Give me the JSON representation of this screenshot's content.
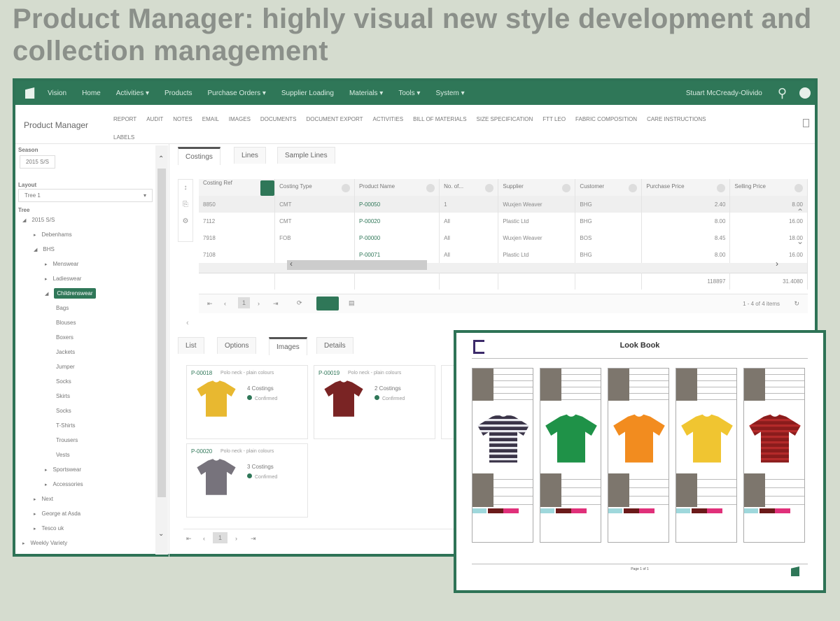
{
  "title": "Product Manager: highly visual new style development and collection management",
  "nav": {
    "brand": "Vision",
    "items": [
      "Home",
      "Activities ▾",
      "Products",
      "Purchase Orders ▾",
      "Supplier Loading",
      "Materials ▾",
      "Tools ▾",
      "System ▾"
    ],
    "user": "Stuart McCready-Olivido"
  },
  "header": {
    "title": "Product Manager",
    "tabs": [
      "REPORT",
      "AUDIT",
      "NOTES",
      "EMAIL",
      "IMAGES",
      "DOCUMENTS",
      "DOCUMENT EXPORT",
      "ACTIVITIES",
      "BILL OF MATERIALS",
      "SIZE SPECIFICATION",
      "FTT LEO",
      "FABRIC COMPOSITION",
      "CARE INSTRUCTIONS",
      "LABELS"
    ]
  },
  "sidebar": {
    "season_label": "Season",
    "season_value": "2015 S/S",
    "layout_label": "Layout",
    "layout_value": "Tree 1",
    "tree_label": "Tree",
    "tree": [
      {
        "t": "2015 S/S",
        "l": 0,
        "e": "◢"
      },
      {
        "t": "Debenhams",
        "l": 1,
        "e": "▸"
      },
      {
        "t": "BHS",
        "l": 1,
        "e": "◢"
      },
      {
        "t": "Menswear",
        "l": 2,
        "e": "▸"
      },
      {
        "t": "Ladieswear",
        "l": 2,
        "e": "▸"
      },
      {
        "t": "Childrenswear",
        "l": 2,
        "e": "◢",
        "sel": true
      },
      {
        "t": "Bags",
        "l": 3
      },
      {
        "t": "Blouses",
        "l": 3
      },
      {
        "t": "Boxers",
        "l": 3
      },
      {
        "t": "Jackets",
        "l": 3
      },
      {
        "t": "Jumper",
        "l": 3
      },
      {
        "t": "Socks",
        "l": 3
      },
      {
        "t": "Skirts",
        "l": 3
      },
      {
        "t": "Socks",
        "l": 3
      },
      {
        "t": "T-Shirts",
        "l": 3
      },
      {
        "t": "Trousers",
        "l": 3
      },
      {
        "t": "Vests",
        "l": 3
      },
      {
        "t": "Sportswear",
        "l": 2,
        "e": "▸"
      },
      {
        "t": "Accessories",
        "l": 2,
        "e": "▸"
      },
      {
        "t": "Next",
        "l": 1,
        "e": "▸"
      },
      {
        "t": "George at Asda",
        "l": 1,
        "e": "▸"
      },
      {
        "t": "Tesco uk",
        "l": 1,
        "e": "▸"
      },
      {
        "t": "Weekly Variety",
        "l": 0,
        "e": "▸"
      }
    ]
  },
  "top_tabs": [
    "Costings",
    "Lines",
    "Sample Lines"
  ],
  "grid": {
    "columns": [
      "Costing Ref",
      "Costing Type",
      "Product Name",
      "No. of...",
      "Supplier",
      "Customer",
      "Purchase Price",
      "Selling Price"
    ],
    "rows": [
      [
        "8850",
        "CMT",
        "P-00050",
        "1",
        "Wuxjen Weaver",
        "BHG",
        "2.40",
        "8.00"
      ],
      [
        "7112",
        "CMT",
        "P-00020",
        "All",
        "Plastic Ltd",
        "BHG",
        "8.00",
        "16.00"
      ],
      [
        "7918",
        "FOB",
        "P-00000",
        "All",
        "Wuxjen Weaver",
        "BOS",
        "8.45",
        "18.00"
      ],
      [
        "7108",
        "",
        "P-00071",
        "All",
        "Plastic Ltd",
        "BHG",
        "8.00",
        "16.00"
      ]
    ],
    "totals": [
      "",
      "",
      "",
      "",
      "",
      "",
      "118897",
      "31.4080"
    ],
    "page": "1",
    "pager_info": "1 - 4 of 4 items"
  },
  "bottom_tabs": [
    "List",
    "Options",
    "Images",
    "Details"
  ],
  "cards": [
    {
      "id": "P-00018",
      "desc": "Polo neck - plain colours",
      "costings": "4 Costings",
      "status": "Confirmed",
      "color": "#e8b830"
    },
    {
      "id": "P-00019",
      "desc": "Polo neck - plain colours",
      "costings": "2 Costings",
      "status": "Confirmed",
      "color": "#7a2424"
    },
    {
      "id": "P-00020",
      "desc": "Polo neck - plain colours",
      "costings": "3 Costings",
      "status": "Confirmed",
      "color": "#77737c"
    }
  ],
  "bottom_page": "1",
  "lookbook": {
    "title": "Look Book",
    "page": "Page 1 of 1",
    "shirts": [
      {
        "color": "#3a3448",
        "stripe": "#e8e8ee"
      },
      {
        "color": "#1f9248"
      },
      {
        "color": "#f28c1f"
      },
      {
        "color": "#f0c531"
      },
      {
        "color": "#8a1c1c",
        "stripe": "#b42a2a"
      }
    ]
  }
}
